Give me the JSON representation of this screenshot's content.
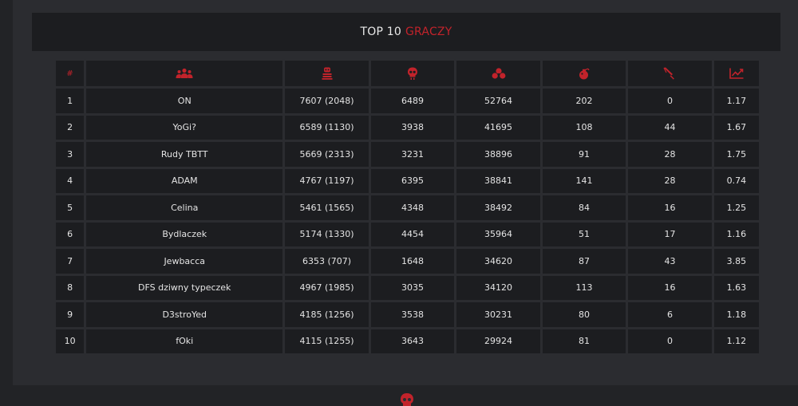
{
  "title": {
    "white": "TOP 10",
    "red": "GRACZY"
  },
  "columns": [
    {
      "icon": "hash",
      "label": "#"
    },
    {
      "icon": "players-icon"
    },
    {
      "icon": "kills-icon"
    },
    {
      "icon": "deaths-icon"
    },
    {
      "icon": "damage-icon"
    },
    {
      "icon": "grenade-icon"
    },
    {
      "icon": "knife-icon"
    },
    {
      "icon": "ratio-chart-icon"
    }
  ],
  "rows": [
    {
      "rank": "1",
      "name": "ON",
      "kills": "7607 (2048)",
      "deaths": "6489",
      "score": "52764",
      "grenade": "202",
      "knife": "0",
      "ratio": "1.17"
    },
    {
      "rank": "2",
      "name": "YoGi?",
      "kills": "6589 (1130)",
      "deaths": "3938",
      "score": "41695",
      "grenade": "108",
      "knife": "44",
      "ratio": "1.67"
    },
    {
      "rank": "3",
      "name": "Rudy TBTT",
      "kills": "5669 (2313)",
      "deaths": "3231",
      "score": "38896",
      "grenade": "91",
      "knife": "28",
      "ratio": "1.75"
    },
    {
      "rank": "4",
      "name": "ADAM",
      "kills": "4767 (1197)",
      "deaths": "6395",
      "score": "38841",
      "grenade": "141",
      "knife": "28",
      "ratio": "0.74"
    },
    {
      "rank": "5",
      "name": "Celina",
      "kills": "5461 (1565)",
      "deaths": "4348",
      "score": "38492",
      "grenade": "84",
      "knife": "16",
      "ratio": "1.25"
    },
    {
      "rank": "6",
      "name": "Bydlaczek",
      "kills": "5174 (1330)",
      "deaths": "4454",
      "score": "35964",
      "grenade": "51",
      "knife": "17",
      "ratio": "1.16"
    },
    {
      "rank": "7",
      "name": "Jewbacca",
      "kills": "6353 (707)",
      "deaths": "1648",
      "score": "34620",
      "grenade": "87",
      "knife": "43",
      "ratio": "3.85"
    },
    {
      "rank": "8",
      "name": "DFS dziwny typeczek",
      "kills": "4967 (1985)",
      "deaths": "3035",
      "score": "34120",
      "grenade": "113",
      "knife": "16",
      "ratio": "1.63"
    },
    {
      "rank": "9",
      "name": "D3stroYed",
      "kills": "4185 (1256)",
      "deaths": "3538",
      "score": "30231",
      "grenade": "80",
      "knife": "6",
      "ratio": "1.18"
    },
    {
      "rank": "10",
      "name": "fOki",
      "kills": "4115 (1255)",
      "deaths": "3643",
      "score": "29924",
      "grenade": "81",
      "knife": "0",
      "ratio": "1.12"
    }
  ],
  "colors": {
    "accent": "#c2232b",
    "cell": "#1c1d20",
    "frame": "#2b2c30",
    "background": "#222326",
    "text": "#e4e4e4"
  }
}
